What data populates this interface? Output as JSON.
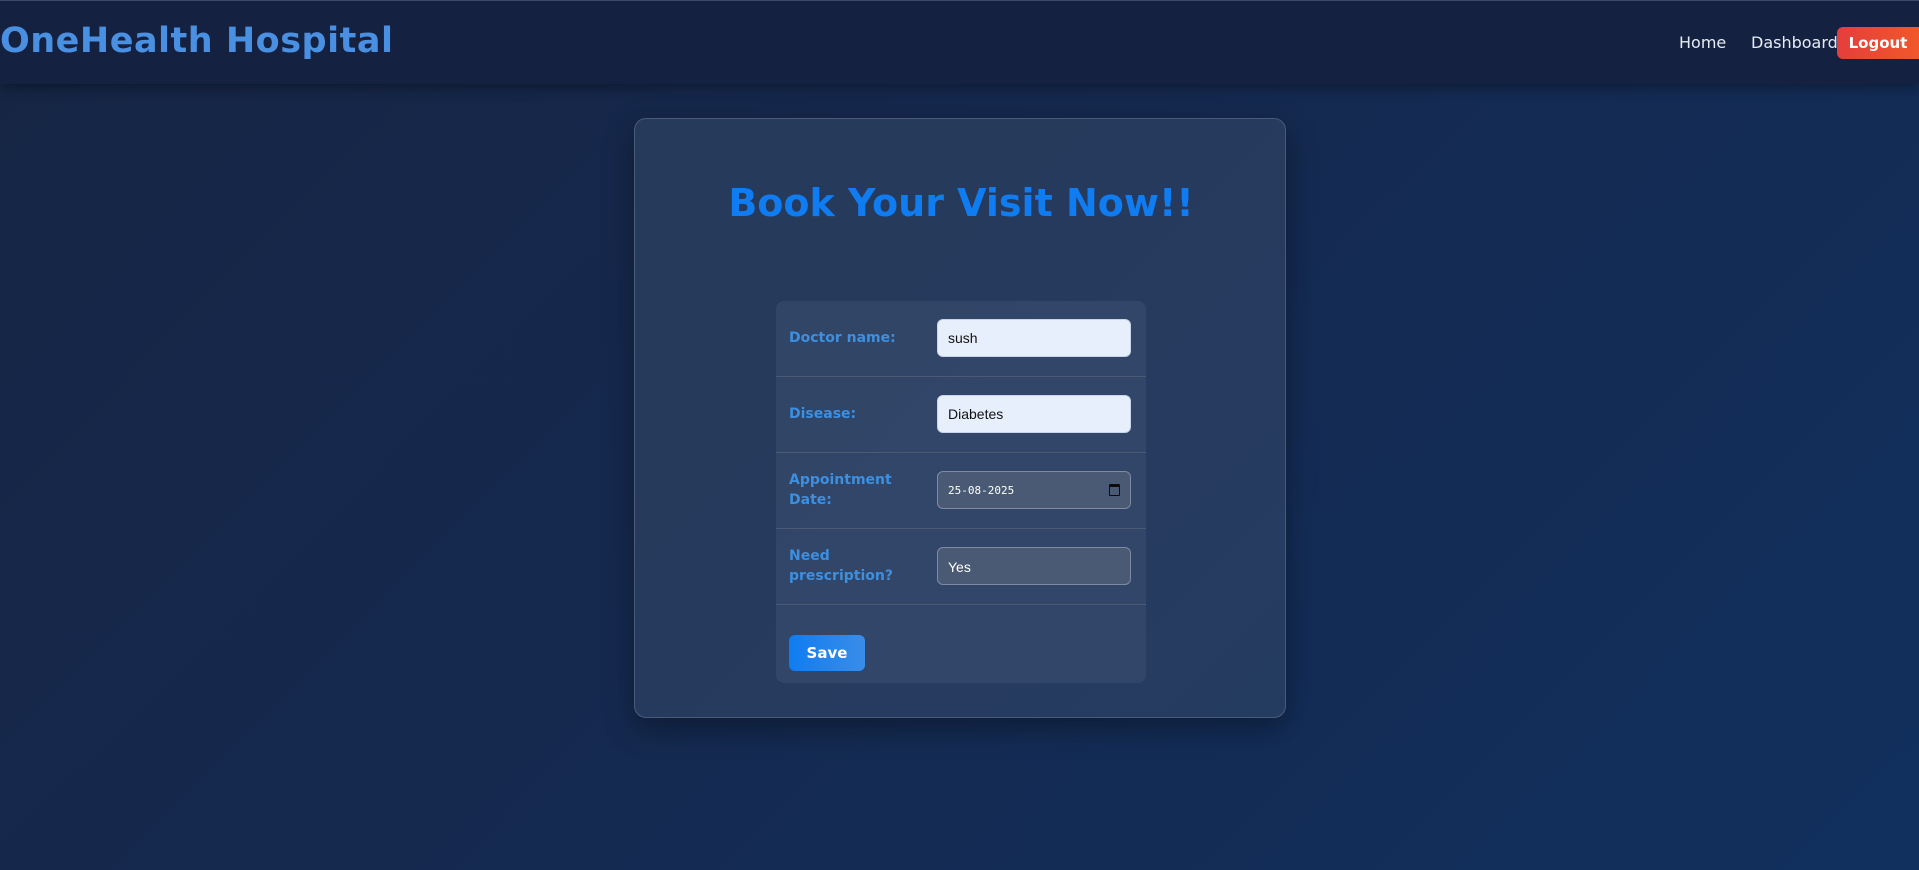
{
  "navbar": {
    "brand": "OneHealth Hospital",
    "links": [
      {
        "label": "Home"
      },
      {
        "label": "Dashboard"
      }
    ],
    "logout_label": "Logout"
  },
  "card": {
    "title": "Book Your Visit Now!!"
  },
  "form": {
    "doctor": {
      "label": "Doctor name:",
      "value": "sush"
    },
    "disease": {
      "label": "Disease:",
      "value": "Diabetes"
    },
    "date": {
      "label_line1": "Appointment",
      "label_line2": "Date:",
      "value": "25-08-2025",
      "icon": "calendar-icon"
    },
    "prescription": {
      "label_line1": "Need",
      "label_line2": "prescription?",
      "value": "Yes"
    },
    "save_label": "Save"
  },
  "colors": {
    "brand": "#4a90e2",
    "title": "#0f7cf2",
    "label": "#3d8fe0",
    "logout_start": "#e53d3d",
    "logout_end": "#f0582a"
  }
}
